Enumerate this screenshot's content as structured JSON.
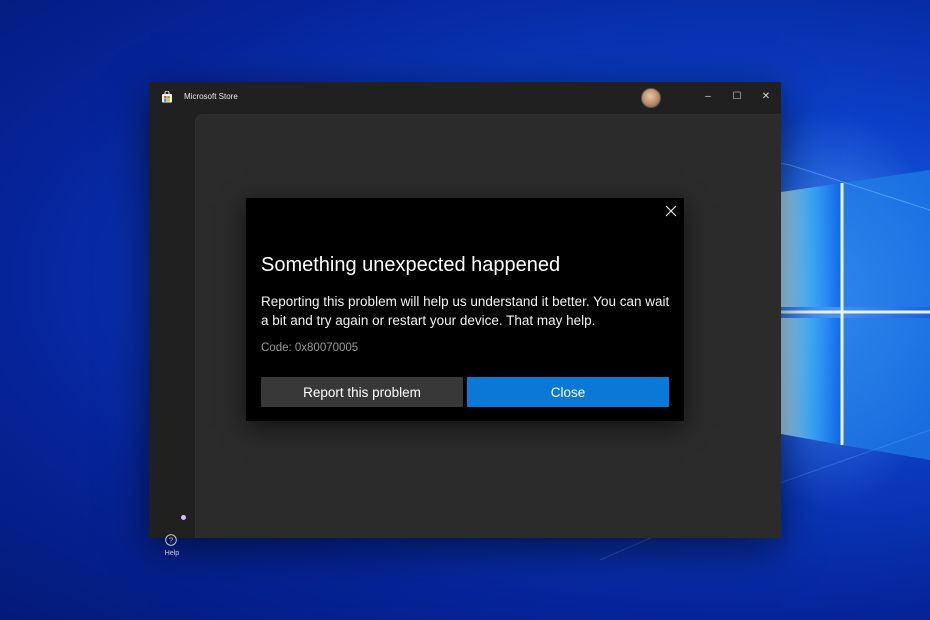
{
  "app": {
    "title": "Microsoft Store",
    "window_controls": {
      "minimize": "–",
      "maximize": "☐",
      "close": "✕"
    }
  },
  "sidebar": {
    "help_label": "Help",
    "help_icon": "question-circle-icon",
    "notification_dot_color": "#e0b8ff"
  },
  "dialog": {
    "title": "Something unexpected happened",
    "body": "Reporting this problem will help us understand it better. You can wait a bit and try again or restart your device. That may help.",
    "code": "Code: 0x80070005",
    "report_button": "Report this problem",
    "close_button": "Close",
    "accent_color": "#0a78d7"
  }
}
